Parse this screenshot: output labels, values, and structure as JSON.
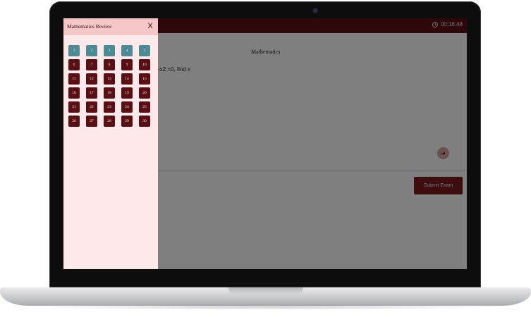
{
  "colors": {
    "topbar": "#5a0f14",
    "panel_bg": "#ffe9ea",
    "panel_header": "#f6c6c8",
    "answered": "#4d8a93",
    "unanswered": "#5a0f14",
    "submit": "#7a1a20"
  },
  "header": {
    "timer_icon": "alarm-clock-icon",
    "timer": "00:18:48"
  },
  "panel": {
    "title": "Mathematics Review",
    "close_icon": "close-icon",
    "close_label": "X",
    "questions": [
      {
        "n": "1",
        "state": "answered"
      },
      {
        "n": "2",
        "state": "answered"
      },
      {
        "n": "3",
        "state": "answered"
      },
      {
        "n": "4",
        "state": "answered"
      },
      {
        "n": "5",
        "state": "answered"
      },
      {
        "n": "6",
        "state": "unanswered"
      },
      {
        "n": "7",
        "state": "unanswered"
      },
      {
        "n": "8",
        "state": "unanswered"
      },
      {
        "n": "9",
        "state": "unanswered"
      },
      {
        "n": "10",
        "state": "unanswered"
      },
      {
        "n": "11",
        "state": "unanswered"
      },
      {
        "n": "12",
        "state": "unanswered"
      },
      {
        "n": "13",
        "state": "unanswered"
      },
      {
        "n": "14",
        "state": "unanswered"
      },
      {
        "n": "15",
        "state": "unanswered"
      },
      {
        "n": "16",
        "state": "unanswered"
      },
      {
        "n": "17",
        "state": "unanswered"
      },
      {
        "n": "18",
        "state": "unanswered"
      },
      {
        "n": "19",
        "state": "unanswered"
      },
      {
        "n": "20",
        "state": "unanswered"
      },
      {
        "n": "21",
        "state": "unanswered"
      },
      {
        "n": "22",
        "state": "unanswered"
      },
      {
        "n": "23",
        "state": "unanswered"
      },
      {
        "n": "24",
        "state": "unanswered"
      },
      {
        "n": "25",
        "state": "unanswered"
      },
      {
        "n": "26",
        "state": "unanswered"
      },
      {
        "n": "27",
        "state": "unanswered"
      },
      {
        "n": "28",
        "state": "unanswered"
      },
      {
        "n": "29",
        "state": "unanswered"
      },
      {
        "n": "30",
        "state": "unanswered"
      }
    ]
  },
  "main": {
    "subject": "Mathematics",
    "question_text": "-x2 =0, find x",
    "next_icon": "arrow-right-icon",
    "next_label": "➜",
    "submit_label": "Submit Exam"
  }
}
